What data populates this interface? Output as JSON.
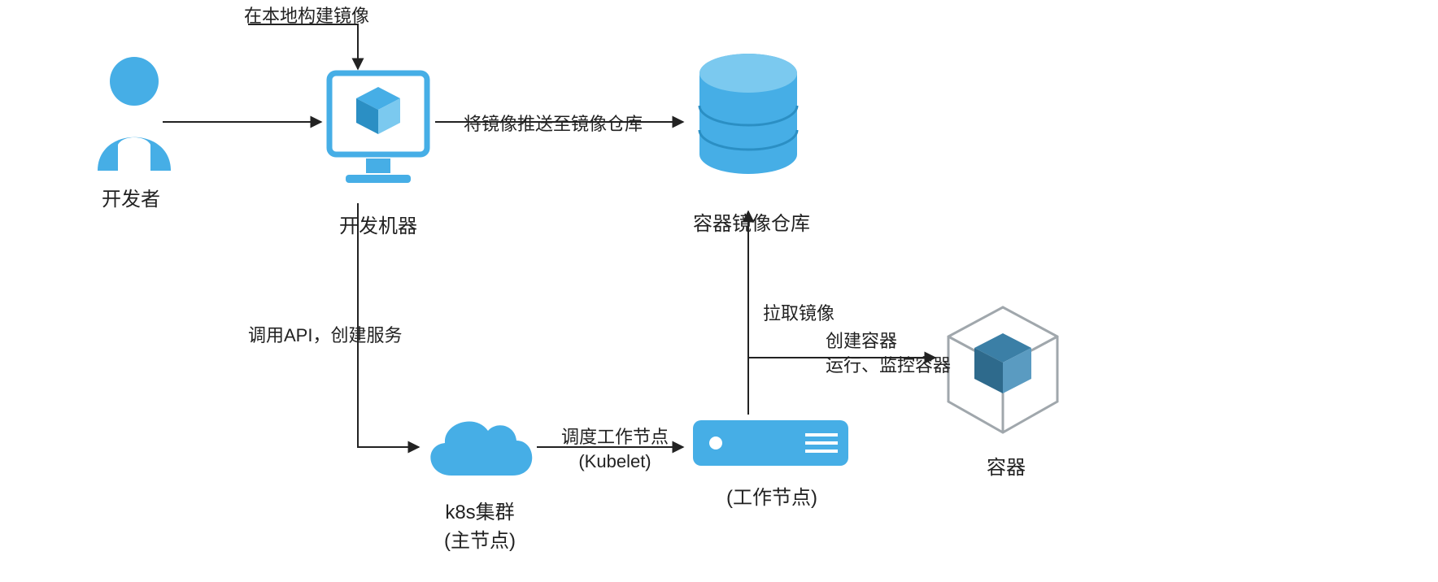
{
  "nodes": {
    "developer": "开发者",
    "dev_machine": "开发机器",
    "repo": "容器镜像仓库",
    "cluster_l1": "k8s集群",
    "cluster_l2": "(主节点)",
    "worker": "(工作节点)",
    "container": "容器"
  },
  "edges": {
    "build": "在本地构建镜像",
    "push": "将镜像推送至镜像仓库",
    "api": "调用API，创建服务",
    "sched_l1": "调度工作节点",
    "sched_l2": "(Kubelet)",
    "pull": "拉取镜像",
    "create_l1": "创建容器",
    "create_l2": "运行、监控容器"
  },
  "colors": {
    "accent": "#46AEE6",
    "node_gray": "#A0A7AC",
    "text": "#222222"
  }
}
